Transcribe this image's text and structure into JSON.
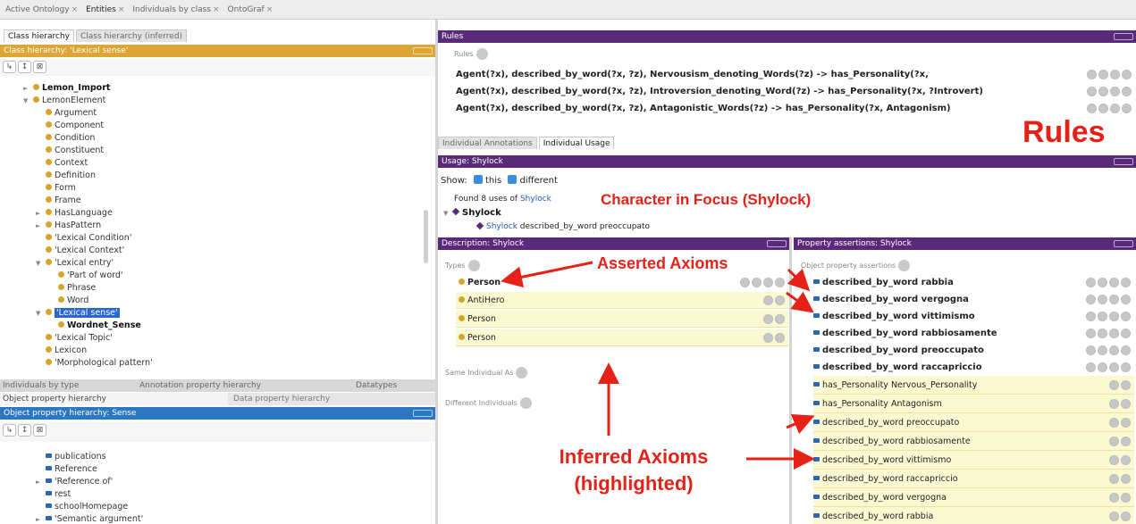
{
  "top_tabs": [
    "Active Ontology",
    "Entities",
    "Individuals by class",
    "OntoGraf"
  ],
  "left_top": {
    "tabs": [
      "Class hierarchy",
      "Class hierarchy (inferred)"
    ],
    "header": "Class hierarchy: 'Lexical sense'",
    "tree": [
      {
        "label": "Lemon_Import",
        "bold": true,
        "arrow": "►",
        "indent": 0
      },
      {
        "label": "LemonElement",
        "arrow": "▼",
        "indent": 0
      },
      {
        "label": "Argument",
        "indent": 1
      },
      {
        "label": "Component",
        "indent": 1
      },
      {
        "label": "Condition",
        "indent": 1
      },
      {
        "label": "Constituent",
        "indent": 1
      },
      {
        "label": "Context",
        "indent": 1
      },
      {
        "label": "Definition",
        "indent": 1
      },
      {
        "label": "Form",
        "indent": 1
      },
      {
        "label": "Frame",
        "indent": 1
      },
      {
        "label": "HasLanguage",
        "arrow": "►",
        "indent": 1
      },
      {
        "label": "HasPattern",
        "arrow": "►",
        "indent": 1
      },
      {
        "label": "'Lexical Condition'",
        "indent": 1
      },
      {
        "label": "'Lexical Context'",
        "indent": 1
      },
      {
        "label": "'Lexical entry'",
        "arrow": "▼",
        "indent": 1
      },
      {
        "label": "'Part of word'",
        "indent": 2
      },
      {
        "label": "Phrase",
        "indent": 2
      },
      {
        "label": "Word",
        "indent": 2
      },
      {
        "label": "'Lexical sense'",
        "arrow": "▼",
        "indent": 1,
        "selected": true
      },
      {
        "label": "Wordnet_Sense",
        "bold": true,
        "indent": 2
      },
      {
        "label": "'Lexical Topic'",
        "indent": 1
      },
      {
        "label": "Lexicon",
        "indent": 1
      },
      {
        "label": "'Morphological pattern'",
        "indent": 1
      }
    ]
  },
  "left_bottom": {
    "tabs_row1": [
      "Individuals by type",
      "Annotation property hierarchy",
      "Datatypes"
    ],
    "tabs_row2": [
      "Object property hierarchy",
      "Data property hierarchy"
    ],
    "header": "Object property hierarchy: Sense",
    "tree": [
      {
        "label": "publications",
        "indent": 1
      },
      {
        "label": "Reference",
        "indent": 1
      },
      {
        "label": "'Reference of'",
        "arrow": "►",
        "indent": 1
      },
      {
        "label": "rest",
        "indent": 1
      },
      {
        "label": "schoolHomepage",
        "indent": 1
      },
      {
        "label": "'Semantic argument'",
        "arrow": "►",
        "indent": 1
      }
    ]
  },
  "rules": {
    "header": "Rules",
    "subheader": "Rules",
    "items": [
      "Agent(?x), described_by_word(?x, ?z), Nervousism_denoting_Words(?z) -> has_Personality(?x,",
      "Agent(?x), described_by_word(?x, ?z), Introversion_denoting_Word(?z) -> has_Personality(?x, ?Introvert)",
      "Agent(?x), described_by_word(?x, ?z), Antagonistic_Words(?z) -> has_Personality(?x, Antagonism)"
    ]
  },
  "usage": {
    "tabs": [
      "Individual Annotations",
      "Individual Usage"
    ],
    "header": "Usage: Shylock",
    "show_label": "Show:",
    "opt_this": "this",
    "opt_different": "different",
    "found_prefix": "Found 8 uses of",
    "found_entity": "Shylock",
    "entity": "Shylock",
    "usage_subject": "Shylock",
    "usage_rest": "described_by_word preoccupato"
  },
  "description": {
    "header": "Description: Shylock",
    "types_label": "Types",
    "asserted": "Person",
    "inferred": [
      "AntiHero",
      "Person",
      "Person"
    ],
    "same_label": "Same Individual As",
    "different_label": "Different Individuals"
  },
  "property": {
    "header": "Property assertions: Shylock",
    "section_label": "Object property assertions",
    "asserted": [
      {
        "prop": "described_by_word",
        "value": "rabbia"
      },
      {
        "prop": "described_by_word",
        "value": "vergogna"
      },
      {
        "prop": "described_by_word",
        "value": "vittimismo"
      },
      {
        "prop": "described_by_word",
        "value": "rabbiosamente"
      },
      {
        "prop": "described_by_word",
        "value": "preoccupato"
      },
      {
        "prop": "described_by_word",
        "value": "raccapriccio"
      }
    ],
    "inferred": [
      {
        "prop": "has_Personality",
        "value": "Nervous_Personality"
      },
      {
        "prop": "has_Personality",
        "value": "Antagonism"
      },
      {
        "prop": "described_by_word",
        "value": "preoccupato"
      },
      {
        "prop": "described_by_word",
        "value": "rabbiosamente"
      },
      {
        "prop": "described_by_word",
        "value": "vittimismo"
      },
      {
        "prop": "described_by_word",
        "value": "raccapriccio"
      },
      {
        "prop": "described_by_word",
        "value": "vergogna"
      },
      {
        "prop": "described_by_word",
        "value": "rabbia"
      }
    ]
  },
  "annotations": {
    "rules": "Rules",
    "focus": "Character in Focus (Shylock)",
    "asserted": "Asserted Axioms",
    "inferred_l1": "Inferred Axioms",
    "inferred_l2": "(highlighted)"
  },
  "colors": {
    "accent_red": "#e52118",
    "header_purple": "#5a2a7a",
    "header_orange": "#dca534",
    "header_blue": "#2b77c4",
    "inferred_bg": "#fbf9d2"
  }
}
